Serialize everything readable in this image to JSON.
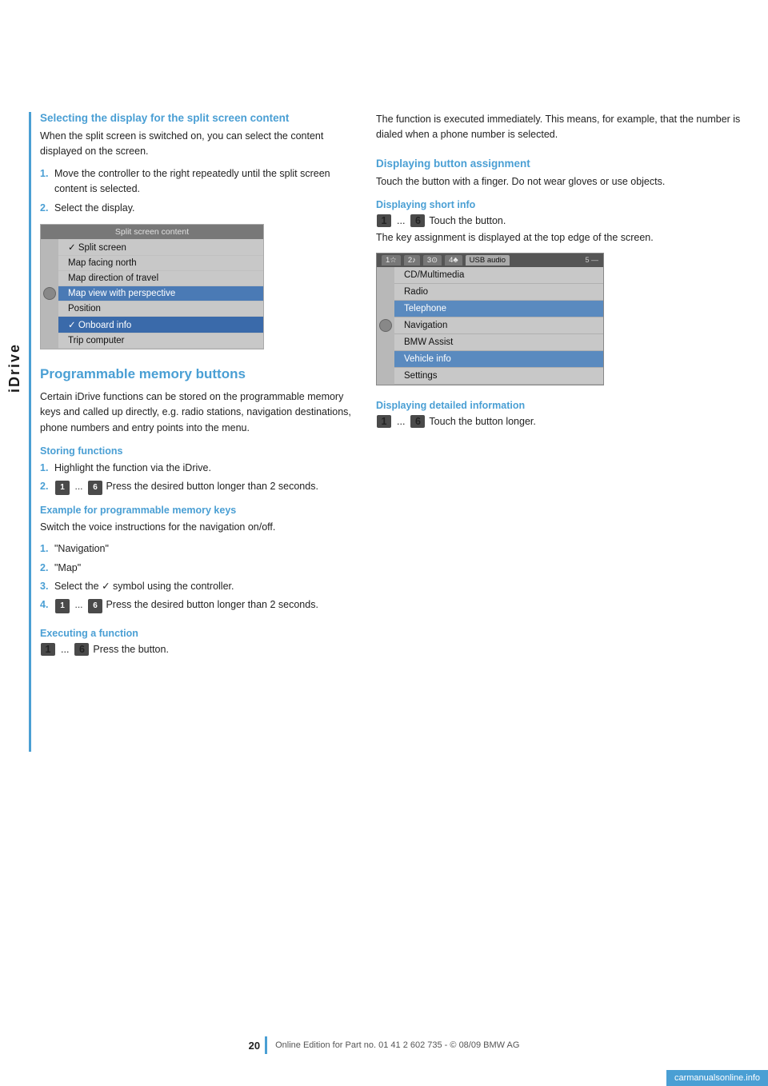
{
  "page": {
    "title": "iDrive",
    "page_number": "20",
    "footer_text": "Online Edition for Part no. 01 41 2 602 735 - © 08/09 BMW AG",
    "site_badge": "carmanualsonline.info"
  },
  "sidebar": {
    "label": "iDrive"
  },
  "left_column": {
    "section1": {
      "heading": "Selecting the display for the split screen content",
      "intro": "When the split screen is switched on, you can select the content displayed on the screen.",
      "steps": [
        "Move the controller to the right repeatedly until the split screen content is selected.",
        "Select the display."
      ],
      "screenshot": {
        "title": "Split screen content",
        "rows": [
          {
            "text": "✓  Split screen",
            "style": "check"
          },
          {
            "text": "Map facing north",
            "style": "normal"
          },
          {
            "text": "Map direction of travel",
            "style": "normal"
          },
          {
            "text": "Map view with perspective",
            "style": "highlighted"
          },
          {
            "text": "Position",
            "style": "normal"
          },
          {
            "text": "✓  Onboard info",
            "style": "onboard"
          },
          {
            "text": "Trip computer",
            "style": "normal"
          }
        ]
      }
    },
    "section2": {
      "heading": "Programmable memory buttons",
      "intro": "Certain iDrive functions can be stored on the programmable memory keys and called up directly, e.g. radio stations, navigation destinations, phone numbers and entry points into the menu.",
      "storing": {
        "heading": "Storing functions",
        "steps": [
          {
            "num": "1.",
            "text": "Highlight the function via the iDrive."
          },
          {
            "num": "2.",
            "text_before": "",
            "badge1": "1",
            "dots": "...",
            "badge2": "6",
            "text_after": "Press the desired button longer than 2 seconds."
          }
        ]
      },
      "example": {
        "heading": "Example for programmable memory keys",
        "intro": "Switch the voice instructions for the navigation on/off.",
        "steps": [
          {
            "num": "1.",
            "text": "\"Navigation\""
          },
          {
            "num": "2.",
            "text": "\"Map\""
          },
          {
            "num": "3.",
            "text": "Select the ✓ symbol using the controller."
          },
          {
            "num": "4.",
            "text_before": "",
            "badge1": "1",
            "dots": "...",
            "badge2": "6",
            "text_after": "Press the desired button longer than 2 seconds."
          }
        ]
      },
      "executing": {
        "heading": "Executing a function",
        "badge1": "1",
        "dots": "...",
        "badge2": "6",
        "text": "Press the button."
      }
    }
  },
  "right_column": {
    "intro_text": "The function is executed immediately. This means, for example, that the number is dialed when a phone number is selected.",
    "section1": {
      "heading": "Displaying button assignment",
      "intro": "Touch the button with a finger. Do not wear gloves or use objects.",
      "short_info": {
        "heading": "Displaying short info",
        "badge1": "1",
        "dots": "...",
        "badge2": "6",
        "text": "Touch the button.",
        "desc": "The key assignment is displayed at the top edge of the screen."
      },
      "screenshot": {
        "tabs": [
          "1",
          "2",
          "3",
          "4",
          "USB audio",
          "5"
        ],
        "rows": [
          {
            "text": "CD/Multimedia",
            "style": "normal"
          },
          {
            "text": "Radio",
            "style": "normal"
          },
          {
            "text": "Telephone",
            "style": "highlighted"
          },
          {
            "text": "Navigation",
            "style": "normal"
          },
          {
            "text": "BMW Assist",
            "style": "normal"
          },
          {
            "text": "Vehicle info",
            "style": "highlighted"
          },
          {
            "text": "Settings",
            "style": "normal"
          }
        ]
      },
      "detailed": {
        "heading": "Displaying detailed information",
        "badge1": "1",
        "dots": "...",
        "badge2": "6",
        "text": "Touch the button longer."
      }
    }
  }
}
